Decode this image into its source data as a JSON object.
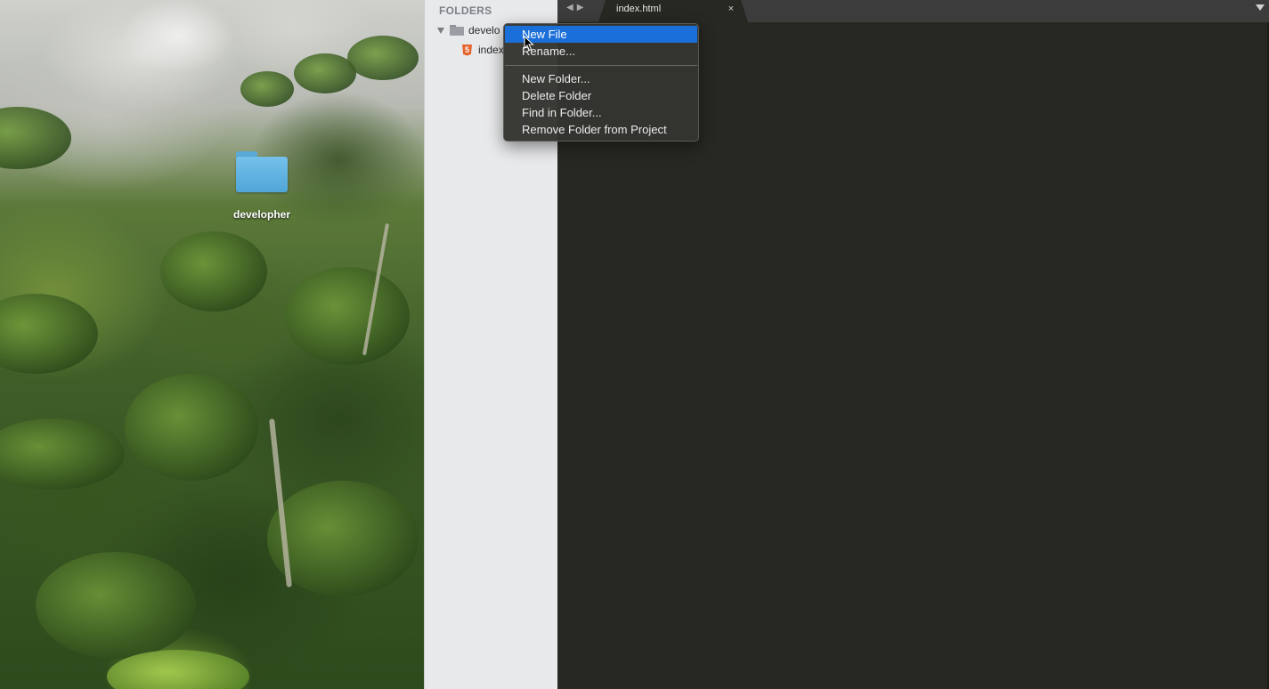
{
  "desktop": {
    "folder_label": "developher"
  },
  "sidebar": {
    "heading": "FOLDERS",
    "folder_name": "develo",
    "file_name": "index"
  },
  "tabs": [
    {
      "title": "index.html",
      "close_glyph": "×"
    }
  ],
  "nav": {
    "back_glyph": "◀",
    "forward_glyph": "▶"
  },
  "context_menu": {
    "items": [
      {
        "label": "New File",
        "highlighted": true
      },
      {
        "label": "Rename..."
      },
      {
        "label": "New Folder..."
      },
      {
        "label": "Delete Folder"
      },
      {
        "label": "Find in Folder..."
      },
      {
        "label": "Remove Folder from Project"
      }
    ]
  },
  "colors": {
    "editor_background": "#272822",
    "menu_highlight": "#1a6fd8",
    "sidebar_background": "#e8e9eb",
    "html_file_icon": "#e5642e",
    "desktop_folder": "#5aa9d6"
  }
}
